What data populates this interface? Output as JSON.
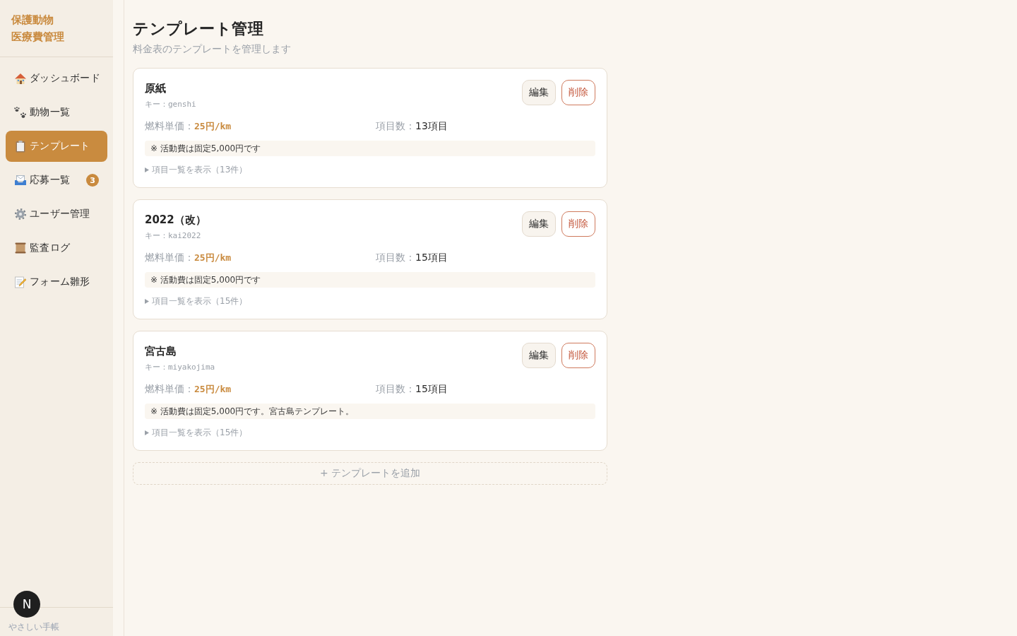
{
  "sidebar": {
    "logo": [
      "保護動物",
      "医療費管理"
    ],
    "items": [
      {
        "label": "ダッシュボード",
        "selected": false
      },
      {
        "label": "動物一覧",
        "selected": false
      },
      {
        "label": "テンプレート",
        "selected": true
      },
      {
        "label": "応募一覧",
        "selected": false,
        "badge": "3"
      },
      {
        "label": "ユーザー管理",
        "selected": false
      },
      {
        "label": "監査ログ",
        "selected": false
      },
      {
        "label": "フォーム雛形",
        "selected": false
      }
    ],
    "footer": "やさしい手帳"
  },
  "dev_badge": "N",
  "header": {
    "title": "テンプレート管理",
    "subtitle": "料金表のテンプレートを管理します"
  },
  "templates": [
    {
      "name": "原紙",
      "key": "キー：genshi",
      "edit": "編集",
      "delete": "削除",
      "fuel_price": {
        "label": "燃料単価：",
        "value": "25円/km"
      },
      "item_count": {
        "label": "項目数：",
        "value": "13項目"
      },
      "note": "※ 活動費は固定5,000円です",
      "toggle": {
        "label": "項目一覧を表示（13件）",
        "expanded": false
      }
    },
    {
      "name": "2022（改）",
      "key": "キー：kai2022",
      "edit": "編集",
      "delete": "削除",
      "fuel_price": {
        "label": "燃料単価：",
        "value": "25円/km"
      },
      "item_count": {
        "label": "項目数：",
        "value": "15項目"
      },
      "note": "※ 活動費は固定5,000円です",
      "toggle": {
        "label": "項目一覧を表示（15件）",
        "expanded": false
      }
    },
    {
      "name": "宮古島",
      "key": "キー：miyakojima",
      "edit": "編集",
      "delete": "削除",
      "fuel_price": {
        "label": "燃料単価：",
        "value": "25円/km"
      },
      "item_count": {
        "label": "項目数：",
        "value": "15項目"
      },
      "note": "※ 活動費は固定5,000円です。宮古島テンプレート。",
      "toggle": {
        "label": "項目一覧を表示（15件）",
        "expanded": false
      }
    }
  ],
  "add_button": "+ テンプレートを追加"
}
